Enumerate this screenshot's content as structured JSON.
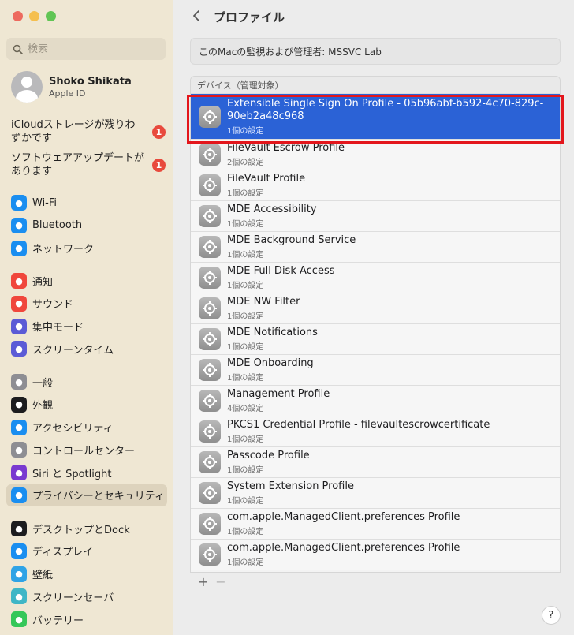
{
  "search": {
    "placeholder": "検索"
  },
  "account": {
    "name": "Shoko Shikata",
    "sub": "Apple ID"
  },
  "notices": [
    {
      "text": "iCloudストレージが残りわずかです",
      "count": "1"
    },
    {
      "text": "ソフトウェアアップデートがあります",
      "count": "1"
    }
  ],
  "sidebar": {
    "group1": [
      {
        "label": "Wi-Fi",
        "icon": "wifi-icon",
        "color": "#1a8ef0"
      },
      {
        "label": "Bluetooth",
        "icon": "bluetooth-icon",
        "color": "#1a8ef0"
      },
      {
        "label": "ネットワーク",
        "icon": "globe-icon",
        "color": "#1a8ef0"
      }
    ],
    "group2": [
      {
        "label": "通知",
        "icon": "bell-icon",
        "color": "#f0473c"
      },
      {
        "label": "サウンド",
        "icon": "speaker-icon",
        "color": "#f0473c"
      },
      {
        "label": "集中モード",
        "icon": "moon-icon",
        "color": "#5b5bd6"
      },
      {
        "label": "スクリーンタイム",
        "icon": "hourglass-icon",
        "color": "#5b5bd6"
      }
    ],
    "group3": [
      {
        "label": "一般",
        "icon": "gear-icon",
        "color": "#8e8e93"
      },
      {
        "label": "外観",
        "icon": "appearance-icon",
        "color": "#1c1c1e"
      },
      {
        "label": "アクセシビリティ",
        "icon": "accessibility-icon",
        "color": "#1a8ef0"
      },
      {
        "label": "コントロールセンター",
        "icon": "control-center-icon",
        "color": "#8e8e93"
      },
      {
        "label": "Siri と Spotlight",
        "icon": "siri-icon",
        "color": "#7a3ad0"
      },
      {
        "label": "プライバシーとセキュリティ",
        "icon": "hand-icon",
        "color": "#1a8ef0"
      }
    ],
    "group4": [
      {
        "label": "デスクトップとDock",
        "icon": "dock-icon",
        "color": "#1c1c1e"
      },
      {
        "label": "ディスプレイ",
        "icon": "display-icon",
        "color": "#1a8ef0"
      },
      {
        "label": "壁紙",
        "icon": "wallpaper-icon",
        "color": "#2fa3e6"
      },
      {
        "label": "スクリーンセーバ",
        "icon": "screensaver-icon",
        "color": "#3fb6c6"
      },
      {
        "label": "バッテリー",
        "icon": "battery-icon",
        "color": "#35c759"
      }
    ]
  },
  "header": {
    "title": "プロファイル"
  },
  "supervised": {
    "text": "このMacの監視および管理者: MSSVC Lab"
  },
  "profiles": {
    "header": "デバイス（管理対象）",
    "items": [
      {
        "name": "Extensible Single Sign On Profile - 05b96abf-b592-4c70-829c-90eb2a48c968",
        "sub": "1個の設定",
        "selected": true
      },
      {
        "name": "FileVault Escrow Profile",
        "sub": "2個の設定"
      },
      {
        "name": "FileVault Profile",
        "sub": "1個の設定"
      },
      {
        "name": "MDE Accessibility",
        "sub": "1個の設定"
      },
      {
        "name": "MDE Background Service",
        "sub": "1個の設定"
      },
      {
        "name": "MDE Full Disk Access",
        "sub": "1個の設定"
      },
      {
        "name": "MDE NW Filter",
        "sub": "1個の設定"
      },
      {
        "name": "MDE Notifications",
        "sub": "1個の設定"
      },
      {
        "name": "MDE Onboarding",
        "sub": "1個の設定"
      },
      {
        "name": "Management Profile",
        "sub": "4個の設定"
      },
      {
        "name": "PKCS1 Credential Profile - filevaultescrowcertificate",
        "sub": "1個の設定"
      },
      {
        "name": "Passcode Profile",
        "sub": "1個の設定"
      },
      {
        "name": "System Extension Profile",
        "sub": "1個の設定"
      },
      {
        "name": "com.apple.ManagedClient.preferences Profile",
        "sub": "1個の設定"
      },
      {
        "name": "com.apple.ManagedClient.preferences Profile",
        "sub": "1個の設定"
      }
    ]
  },
  "footer": {
    "add": "+",
    "remove": "−",
    "help": "?"
  }
}
